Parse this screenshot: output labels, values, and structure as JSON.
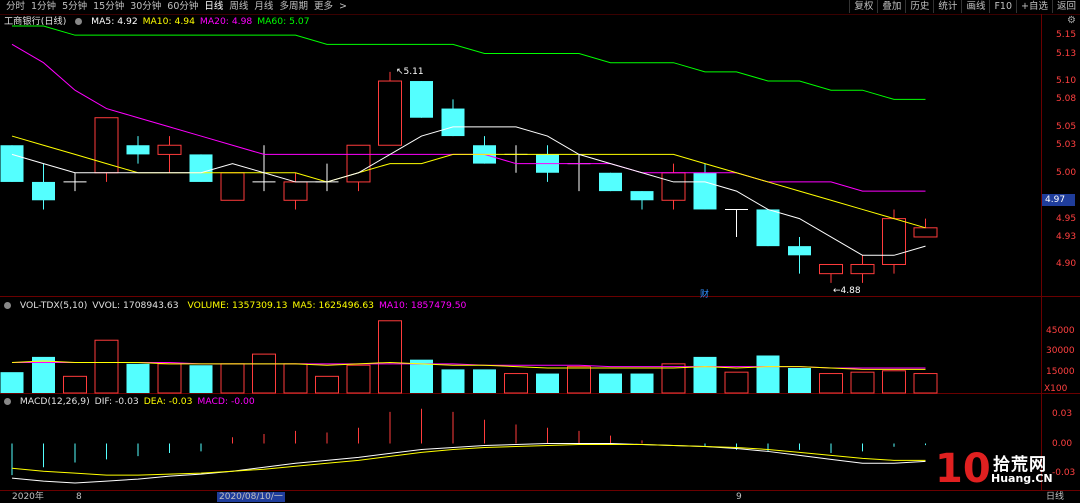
{
  "toolbar": {
    "periods": [
      "分时",
      "1分钟",
      "5分钟",
      "15分钟",
      "30分钟",
      "60分钟",
      "日线",
      "周线",
      "月线",
      "多周期",
      "更多"
    ],
    "active_period": "日线",
    "more_arrow": ">",
    "right_buttons": [
      "复权",
      "叠加",
      "历史",
      "统计",
      "画线",
      "F10",
      "+自选",
      "返回"
    ]
  },
  "main_info": {
    "title": "工商银行(日线)",
    "ma5": "MA5: 4.92",
    "ma10": "MA10: 4.94",
    "ma20": "MA20: 4.98",
    "ma60": "MA60: 5.07"
  },
  "vol_info": {
    "title": "VOL-TDX(5,10)",
    "vvol": "VVOL: 1708943.63",
    "volume": "VOLUME: 1357309.13",
    "ma5": "MA5: 1625496.63",
    "ma10": "MA10: 1857479.50"
  },
  "macd_info": {
    "title": "MACD(12,26,9)",
    "dif": "DIF: -0.03",
    "dea": "DEA: -0.03",
    "macd": "MACD: -0.00"
  },
  "price_axis": [
    "5.15",
    "5.13",
    "5.10",
    "5.08",
    "5.05",
    "5.03",
    "5.00",
    "4.95",
    "4.93",
    "4.90"
  ],
  "current_price": "4.97",
  "vol_axis": [
    "45000",
    "30000",
    "15000"
  ],
  "vol_unit": "X100",
  "macd_axis": [
    "0.03",
    "0.00",
    "-0.03"
  ],
  "annotations": {
    "high": "5.11",
    "low": "4.88",
    "cai": "财"
  },
  "date_axis": {
    "year": "2020年",
    "m8": "8",
    "selected": "2020/08/10/一",
    "m9": "9",
    "period": "日线"
  },
  "watermark": {
    "num": "10",
    "cn": "拾荒网",
    "url": "Huang.CN"
  },
  "colors": {
    "up": "#ff3c3c",
    "down": "#54ffff",
    "ma5": "#ffffff",
    "ma10": "#ffff00",
    "ma20": "#ff00ff",
    "ma60": "#00ff00"
  },
  "chart_data": {
    "type": "candlestick",
    "price_range": [
      4.87,
      5.16
    ],
    "candles": [
      {
        "o": 5.03,
        "h": 5.03,
        "l": 4.99,
        "c": 4.99
      },
      {
        "o": 4.99,
        "h": 5.01,
        "l": 4.96,
        "c": 4.97
      },
      {
        "o": 4.99,
        "h": 5.0,
        "l": 4.98,
        "c": 4.99
      },
      {
        "o": 5.0,
        "h": 5.06,
        "l": 4.99,
        "c": 5.06
      },
      {
        "o": 5.03,
        "h": 5.04,
        "l": 5.01,
        "c": 5.02
      },
      {
        "o": 5.02,
        "h": 5.04,
        "l": 5.0,
        "c": 5.03
      },
      {
        "o": 5.02,
        "h": 5.02,
        "l": 4.99,
        "c": 4.99
      },
      {
        "o": 4.97,
        "h": 5.0,
        "l": 4.97,
        "c": 5.0
      },
      {
        "o": 4.99,
        "h": 5.03,
        "l": 4.98,
        "c": 4.99
      },
      {
        "o": 4.97,
        "h": 5.0,
        "l": 4.96,
        "c": 4.99
      },
      {
        "o": 4.99,
        "h": 5.01,
        "l": 4.98,
        "c": 4.99
      },
      {
        "o": 4.99,
        "h": 5.03,
        "l": 4.98,
        "c": 5.03
      },
      {
        "o": 5.03,
        "h": 5.11,
        "l": 5.03,
        "c": 5.1
      },
      {
        "o": 5.1,
        "h": 5.1,
        "l": 5.06,
        "c": 5.06
      },
      {
        "o": 5.07,
        "h": 5.08,
        "l": 5.04,
        "c": 5.04
      },
      {
        "o": 5.03,
        "h": 5.04,
        "l": 5.01,
        "c": 5.01
      },
      {
        "o": 5.02,
        "h": 5.03,
        "l": 5.0,
        "c": 5.02
      },
      {
        "o": 5.02,
        "h": 5.03,
        "l": 4.99,
        "c": 5.0
      },
      {
        "o": 5.01,
        "h": 5.02,
        "l": 4.98,
        "c": 5.01
      },
      {
        "o": 5.0,
        "h": 5.0,
        "l": 4.98,
        "c": 4.98
      },
      {
        "o": 4.98,
        "h": 4.98,
        "l": 4.96,
        "c": 4.97
      },
      {
        "o": 4.97,
        "h": 5.01,
        "l": 4.96,
        "c": 5.0
      },
      {
        "o": 5.0,
        "h": 5.01,
        "l": 4.96,
        "c": 4.96
      },
      {
        "o": 4.96,
        "h": 4.96,
        "l": 4.93,
        "c": 4.96
      },
      {
        "o": 4.96,
        "h": 4.96,
        "l": 4.92,
        "c": 4.92
      },
      {
        "o": 4.92,
        "h": 4.93,
        "l": 4.89,
        "c": 4.91
      },
      {
        "o": 4.89,
        "h": 4.9,
        "l": 4.88,
        "c": 4.9
      },
      {
        "o": 4.89,
        "h": 4.91,
        "l": 4.88,
        "c": 4.9
      },
      {
        "o": 4.9,
        "h": 4.96,
        "l": 4.89,
        "c": 4.95
      },
      {
        "o": 4.93,
        "h": 4.95,
        "l": 4.93,
        "c": 4.94
      }
    ],
    "ma5": [
      5.02,
      5.01,
      5.0,
      5.0,
      5.0,
      5.0,
      5.0,
      5.01,
      5.0,
      4.99,
      4.99,
      5.0,
      5.02,
      5.04,
      5.05,
      5.05,
      5.05,
      5.04,
      5.02,
      5.01,
      5.0,
      4.99,
      4.99,
      4.98,
      4.96,
      4.95,
      4.93,
      4.91,
      4.91,
      4.92
    ],
    "ma10": [
      5.04,
      5.03,
      5.02,
      5.01,
      5.0,
      5.0,
      5.0,
      5.0,
      5.0,
      5.0,
      4.99,
      5.0,
      5.01,
      5.01,
      5.02,
      5.02,
      5.02,
      5.02,
      5.02,
      5.02,
      5.02,
      5.02,
      5.01,
      5.0,
      4.99,
      4.98,
      4.97,
      4.96,
      4.95,
      4.94
    ],
    "ma20": [
      5.14,
      5.12,
      5.09,
      5.07,
      5.06,
      5.05,
      5.04,
      5.03,
      5.02,
      5.02,
      5.02,
      5.02,
      5.02,
      5.02,
      5.02,
      5.02,
      5.01,
      5.01,
      5.01,
      5.01,
      5.0,
      5.0,
      5.0,
      5.0,
      4.99,
      4.99,
      4.99,
      4.98,
      4.98,
      4.98
    ],
    "ma60": [
      5.16,
      5.16,
      5.15,
      5.15,
      5.15,
      5.15,
      5.15,
      5.15,
      5.15,
      5.15,
      5.14,
      5.14,
      5.14,
      5.14,
      5.14,
      5.13,
      5.13,
      5.13,
      5.13,
      5.12,
      5.12,
      5.12,
      5.11,
      5.11,
      5.1,
      5.1,
      5.09,
      5.09,
      5.08,
      5.08
    ],
    "volume": [
      15000,
      26000,
      12000,
      38000,
      21000,
      21000,
      20000,
      21000,
      28000,
      21000,
      12000,
      20000,
      52000,
      24000,
      17000,
      17000,
      14000,
      14000,
      19000,
      14000,
      14000,
      21000,
      26000,
      15000,
      27000,
      18000,
      14000,
      15000,
      16000,
      14000
    ],
    "vol_ma": [
      22000,
      23000,
      22000,
      22000,
      22000,
      21000,
      21000,
      21000,
      21000,
      21000,
      20000,
      21000,
      22000,
      21000,
      20000,
      20000,
      19000,
      18000,
      18000,
      18000,
      18000,
      18000,
      19000,
      18000,
      19000,
      19000,
      18000,
      17000,
      17000,
      17000
    ],
    "vol_ma10": [
      22000,
      22000,
      22000,
      22000,
      22000,
      22000,
      21000,
      21000,
      21000,
      21000,
      21000,
      21000,
      21000,
      21000,
      21000,
      20000,
      20000,
      20000,
      20000,
      19000,
      19000,
      19000,
      19000,
      19000,
      19000,
      19000,
      18000,
      18000,
      18000,
      18000
    ],
    "vol_range": [
      0,
      54000
    ],
    "macd": [
      -0.02,
      -0.015,
      -0.012,
      -0.01,
      -0.008,
      -0.006,
      -0.005,
      0.004,
      0.006,
      0.008,
      0.007,
      0.01,
      0.02,
      0.022,
      0.02,
      0.015,
      0.012,
      0.01,
      0.008,
      0.005,
      0.002,
      0.0,
      -0.002,
      -0.004,
      -0.005,
      -0.004,
      -0.006,
      -0.005,
      -0.002,
      -0.001
    ],
    "dif": [
      -0.035,
      -0.038,
      -0.04,
      -0.038,
      -0.036,
      -0.033,
      -0.031,
      -0.028,
      -0.024,
      -0.02,
      -0.017,
      -0.014,
      -0.01,
      -0.006,
      -0.004,
      -0.002,
      -0.001,
      0.0,
      0.0,
      0.0,
      -0.001,
      -0.002,
      -0.003,
      -0.005,
      -0.008,
      -0.012,
      -0.016,
      -0.02,
      -0.02,
      -0.018
    ],
    "dea": [
      -0.025,
      -0.028,
      -0.03,
      -0.032,
      -0.032,
      -0.031,
      -0.03,
      -0.028,
      -0.026,
      -0.023,
      -0.02,
      -0.017,
      -0.013,
      -0.009,
      -0.006,
      -0.004,
      -0.003,
      -0.002,
      -0.001,
      -0.001,
      -0.001,
      -0.002,
      -0.003,
      -0.004,
      -0.006,
      -0.009,
      -0.012,
      -0.015,
      -0.017,
      -0.017
    ],
    "macd_range": [
      -0.045,
      0.04
    ]
  }
}
